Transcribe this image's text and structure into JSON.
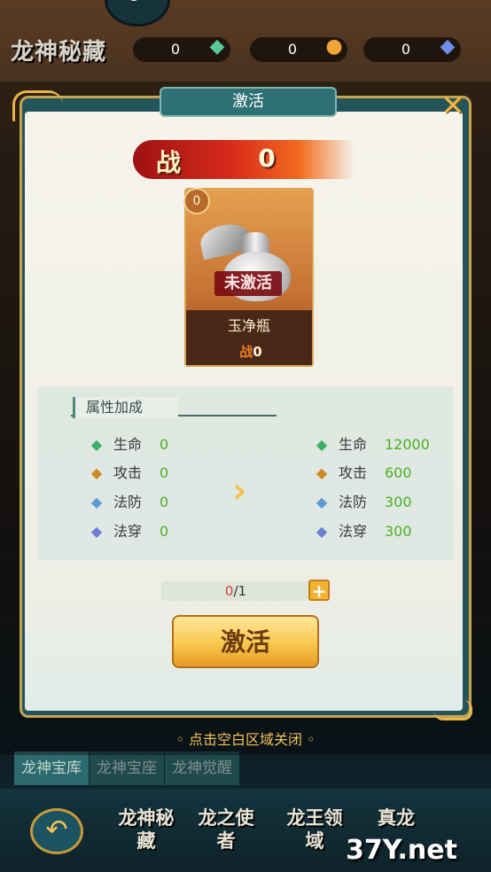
{
  "background": {
    "title": "龙神秘藏",
    "currencies": [
      {
        "value": "0",
        "icon": "green-crystal-icon"
      },
      {
        "value": "0",
        "icon": "gold-ingot-icon"
      },
      {
        "value": "0",
        "icon": "blue-gem-icon"
      }
    ],
    "tabs": [
      "龙神宝库",
      "龙神宝座",
      "龙神觉醒"
    ],
    "nav": [
      {
        "label": "龙神秘藏"
      },
      {
        "label": "龙之使者"
      },
      {
        "label": "龙王领域"
      },
      {
        "label": "真龙"
      }
    ],
    "watermark": "37Y.net"
  },
  "dialog": {
    "title": "激活",
    "power_label": "战",
    "power_value": "0",
    "item": {
      "level": "0",
      "status": "未激活",
      "name": "玉净瓶",
      "power_prefix": "战",
      "power_value": "0"
    },
    "attributes": {
      "header": "属性加成",
      "current": [
        {
          "name": "生命",
          "value": "0",
          "icon": "life-icon"
        },
        {
          "name": "攻击",
          "value": "0",
          "icon": "attack-icon"
        },
        {
          "name": "法防",
          "value": "0",
          "icon": "magic-defense-icon"
        },
        {
          "name": "法穿",
          "value": "0",
          "icon": "magic-penetration-icon"
        }
      ],
      "next": [
        {
          "name": "生命",
          "value": "12000",
          "icon": "life-icon"
        },
        {
          "name": "攻击",
          "value": "600",
          "icon": "attack-icon"
        },
        {
          "name": "法防",
          "value": "300",
          "icon": "magic-defense-icon"
        },
        {
          "name": "法穿",
          "value": "300",
          "icon": "magic-penetration-icon"
        }
      ]
    },
    "progress": {
      "current": "0",
      "total": "/1",
      "fraction": 0
    },
    "activate_label": "激活",
    "close_hint": "◦ 点击空白区域关闭 ◦"
  }
}
